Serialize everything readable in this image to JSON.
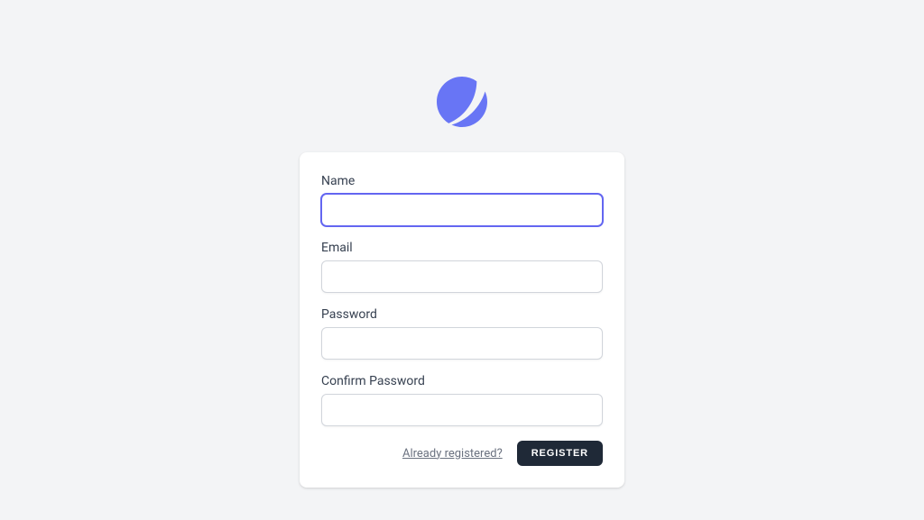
{
  "logo": {
    "name": "app-logo",
    "color": "#6875f5"
  },
  "form": {
    "fields": {
      "name": {
        "label": "Name",
        "value": ""
      },
      "email": {
        "label": "Email",
        "value": ""
      },
      "password": {
        "label": "Password",
        "value": ""
      },
      "confirm_password": {
        "label": "Confirm Password",
        "value": ""
      }
    },
    "link": {
      "label": "Already registered?"
    },
    "submit": {
      "label": "Register"
    }
  }
}
